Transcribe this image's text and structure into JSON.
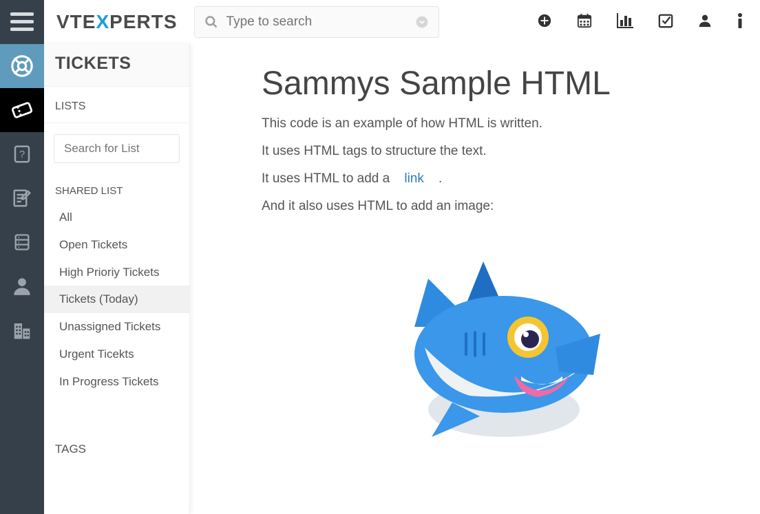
{
  "logo": {
    "pre": "VTE",
    "x": "X",
    "post": "PERTS"
  },
  "search": {
    "placeholder": "Type to search"
  },
  "sidebar": {
    "title": "TICKETS",
    "lists_label": "LISTS",
    "search_placeholder": "Search for List",
    "shared_label": "SHARED LIST",
    "items": [
      {
        "label": "All"
      },
      {
        "label": "Open Tickets"
      },
      {
        "label": "High Prioriy Tickets"
      },
      {
        "label": "Tickets (Today)"
      },
      {
        "label": "Unassigned Tickets"
      },
      {
        "label": "Urgent Ticekts"
      },
      {
        "label": "In Progress Tickets"
      }
    ],
    "tags_label": "TAGS"
  },
  "content": {
    "heading": "Sammys Sample HTML",
    "p1": "This code is an example of how HTML is written.",
    "p2": "It uses HTML tags to structure the text.",
    "p3_pre": "It uses HTML to add a ",
    "p3_link": "link",
    "p3_post": " .",
    "p4": "And it also uses HTML to add an image:"
  }
}
